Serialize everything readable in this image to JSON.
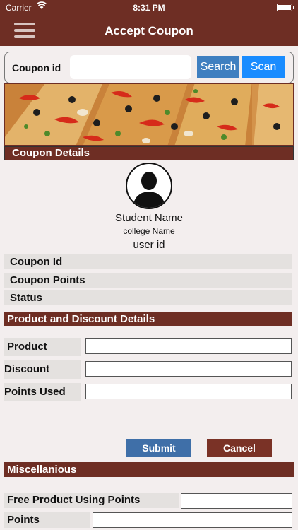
{
  "status_bar": {
    "carrier": "Carrier",
    "time": "8:31 PM"
  },
  "nav": {
    "title": "Accept Coupon"
  },
  "search": {
    "label": "Coupon id",
    "value": "",
    "search_button": "Search",
    "scan_button": "Scan"
  },
  "coupon_details": {
    "header": "Coupon Details",
    "student_name": "Student Name",
    "college_name": "college Name",
    "user_id": "user id",
    "rows": [
      "Coupon Id",
      "Coupon Points",
      "Status"
    ]
  },
  "product_details": {
    "header": "Product and Discount Details",
    "fields": [
      {
        "label": "Product",
        "value": ""
      },
      {
        "label": "Discount",
        "value": ""
      },
      {
        "label": "Points Used",
        "value": ""
      }
    ],
    "submit_button": "Submit",
    "cancel_button": "Cancel"
  },
  "misc": {
    "header": "Miscellanious",
    "fields": [
      {
        "label": "Free Product Using Points",
        "value": ""
      },
      {
        "label": "Points",
        "value": ""
      }
    ]
  },
  "colors": {
    "brand": "#6e2e24",
    "search_button": "#3f7fc0",
    "scan_button": "#1a8cff",
    "submit_button": "#3f6fa8",
    "cancel_button": "#7a3226"
  },
  "icons": {
    "menu": "hamburger-icon",
    "wifi": "wifi-icon",
    "battery": "battery-icon",
    "avatar": "user-silhouette-icon"
  }
}
